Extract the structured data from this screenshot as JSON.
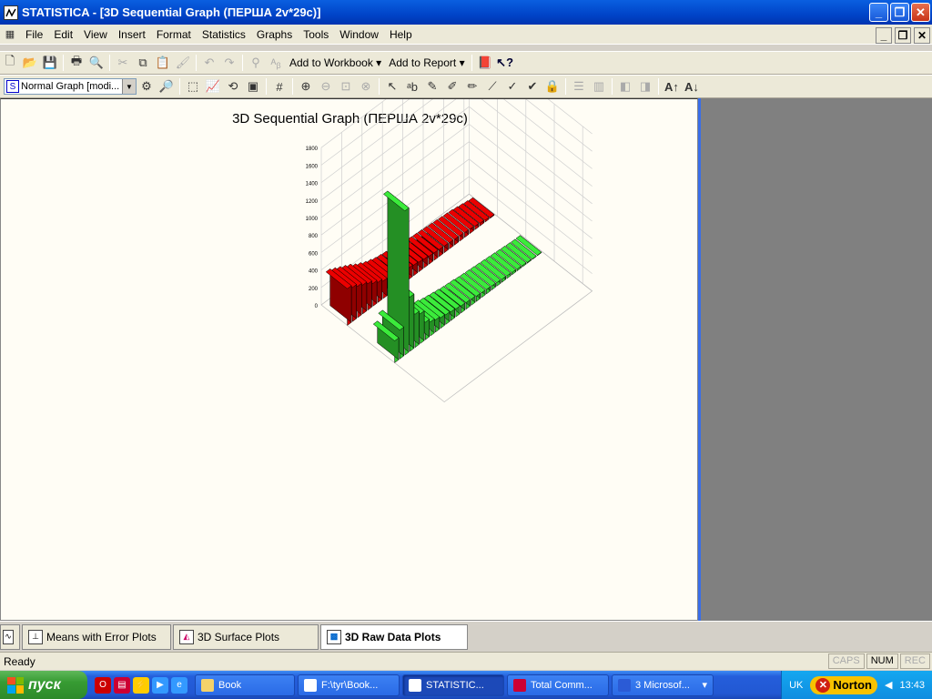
{
  "window": {
    "title": "STATISTICA - [3D Sequential Graph (ПЕРША 2v*29c)]"
  },
  "menu": [
    "File",
    "Edit",
    "View",
    "Insert",
    "Format",
    "Statistics",
    "Graphs",
    "Tools",
    "Window",
    "Help"
  ],
  "toolbar1": {
    "add_to_workbook": "Add to Workbook",
    "add_to_report": "Add to Report"
  },
  "toolbar2": {
    "graph_mode": "Normal Graph [modi..."
  },
  "chart_data": {
    "type": "bar",
    "title": "3D Sequential Graph (ПЕРША 2v*29c)",
    "z_ticks": [
      "0",
      "200",
      "400",
      "600",
      "800",
      "1000",
      "1200",
      "1400",
      "1600",
      "1800"
    ],
    "zlim": [
      0,
      1800
    ],
    "series": [
      {
        "color": "#cc0000",
        "values": [
          420,
          390,
          360,
          330,
          300,
          260,
          230,
          200,
          180,
          160,
          150,
          140,
          130,
          120,
          110,
          100,
          90,
          85,
          80,
          75,
          70,
          65,
          60,
          55,
          50,
          40,
          30,
          20,
          10
        ]
      },
      {
        "color": "#33cc33",
        "values": [
          250,
          330,
          1650,
          620,
          380,
          340,
          200,
          160,
          140,
          120,
          110,
          100,
          90,
          80,
          75,
          70,
          60,
          55,
          50,
          45,
          40,
          35,
          30,
          25,
          20,
          15,
          10,
          5,
          5
        ]
      }
    ]
  },
  "tabs": [
    "Means with Error Plots",
    "3D Surface Plots",
    "3D Raw Data Plots"
  ],
  "status": {
    "text": "Ready",
    "caps": "CAPS",
    "num": "NUM",
    "rec": "REC"
  },
  "taskbar": {
    "start": "пуск",
    "tasks": [
      "Book",
      "F:\\tyr\\Book...",
      "STATISTIC...",
      "Total Comm...",
      "3 Microsof..."
    ],
    "lang": "UK",
    "norton": "Norton",
    "clock": "13:43"
  }
}
